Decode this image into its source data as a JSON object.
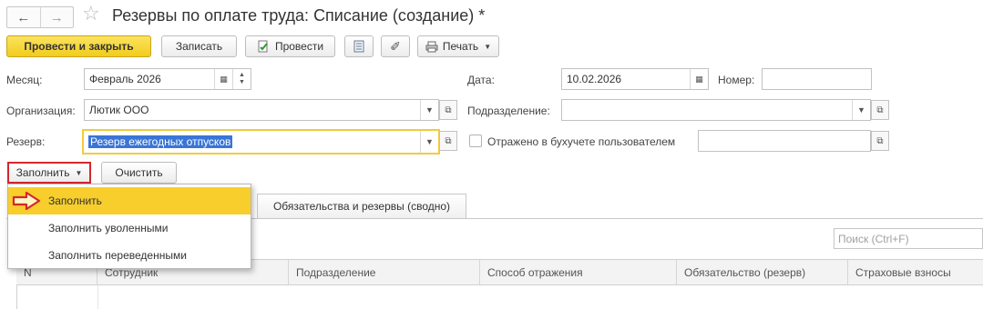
{
  "window": {
    "title": "Резервы по оплате труда: Списание (создание) *"
  },
  "nav": {
    "back_icon": "arrow-left-icon",
    "forward_icon": "arrow-right-icon",
    "favorite_icon": "star-icon"
  },
  "toolbar": {
    "post_close": "Провести и закрыть",
    "save": "Записать",
    "post": "Провести",
    "print": "Печать"
  },
  "form": {
    "month_label": "Месяц:",
    "month_value": "Февраль 2026",
    "date_label": "Дата:",
    "date_value": "10.02.2026",
    "number_label": "Номер:",
    "number_value": "",
    "org_label": "Организация:",
    "org_value": "Лютик ООО",
    "division_label": "Подразделение:",
    "division_value": "",
    "reserve_label": "Резерв:",
    "reserve_value": "Резерв ежегодных отпусков",
    "accounting_checkbox_label": "Отражено в бухучете пользователем",
    "accounting_checked": false
  },
  "actions": {
    "fill": "Заполнить",
    "clear": "Очистить"
  },
  "fill_menu": {
    "items": [
      "Заполнить",
      "Заполнить уволенными",
      "Заполнить переведенными"
    ],
    "active_index": 0
  },
  "tabs": [
    "Обязательства и резервы (сводно)"
  ],
  "search": {
    "placeholder": "Поиск (Ctrl+F)"
  },
  "table": {
    "columns": [
      "N",
      "Сотрудник",
      "Подразделение",
      "Способ отражения",
      "Обязательство (резерв)",
      "Страховые взносы"
    ]
  },
  "colors": {
    "primary": "#f2cc1c",
    "highlight": "#d4272d",
    "selection": "#3875d7",
    "menu_active": "#f7ce2b"
  }
}
